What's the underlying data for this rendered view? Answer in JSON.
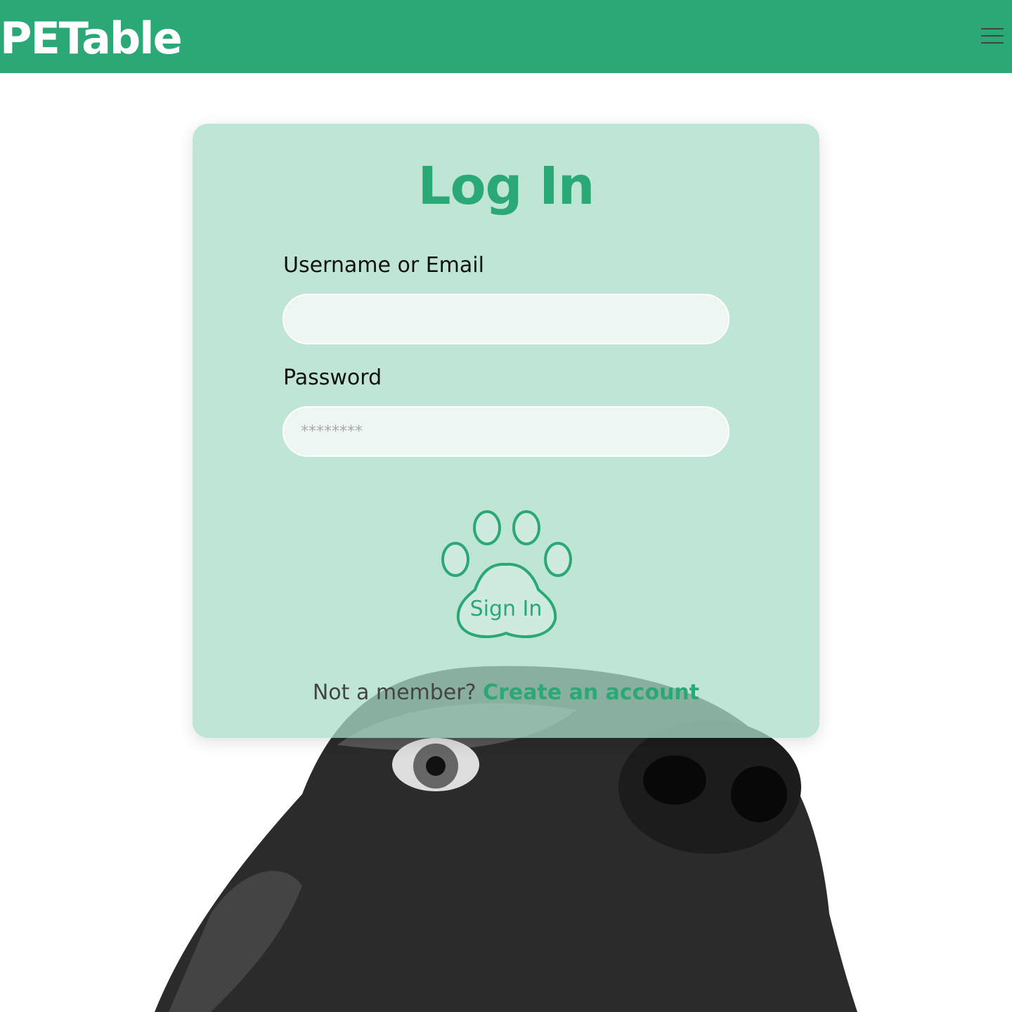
{
  "header": {
    "brand": "PETable",
    "menu_icon": "hamburger-icon"
  },
  "login": {
    "title": "Log In",
    "username_label": "Username or Email",
    "username_value": "",
    "password_label": "Password",
    "password_placeholder": "********",
    "sign_in_label": "Sign In",
    "footer_text": "Not a member?",
    "create_account_link": "Create an account"
  },
  "colors": {
    "brand": "#2aa876",
    "card": "#bee3d5"
  }
}
